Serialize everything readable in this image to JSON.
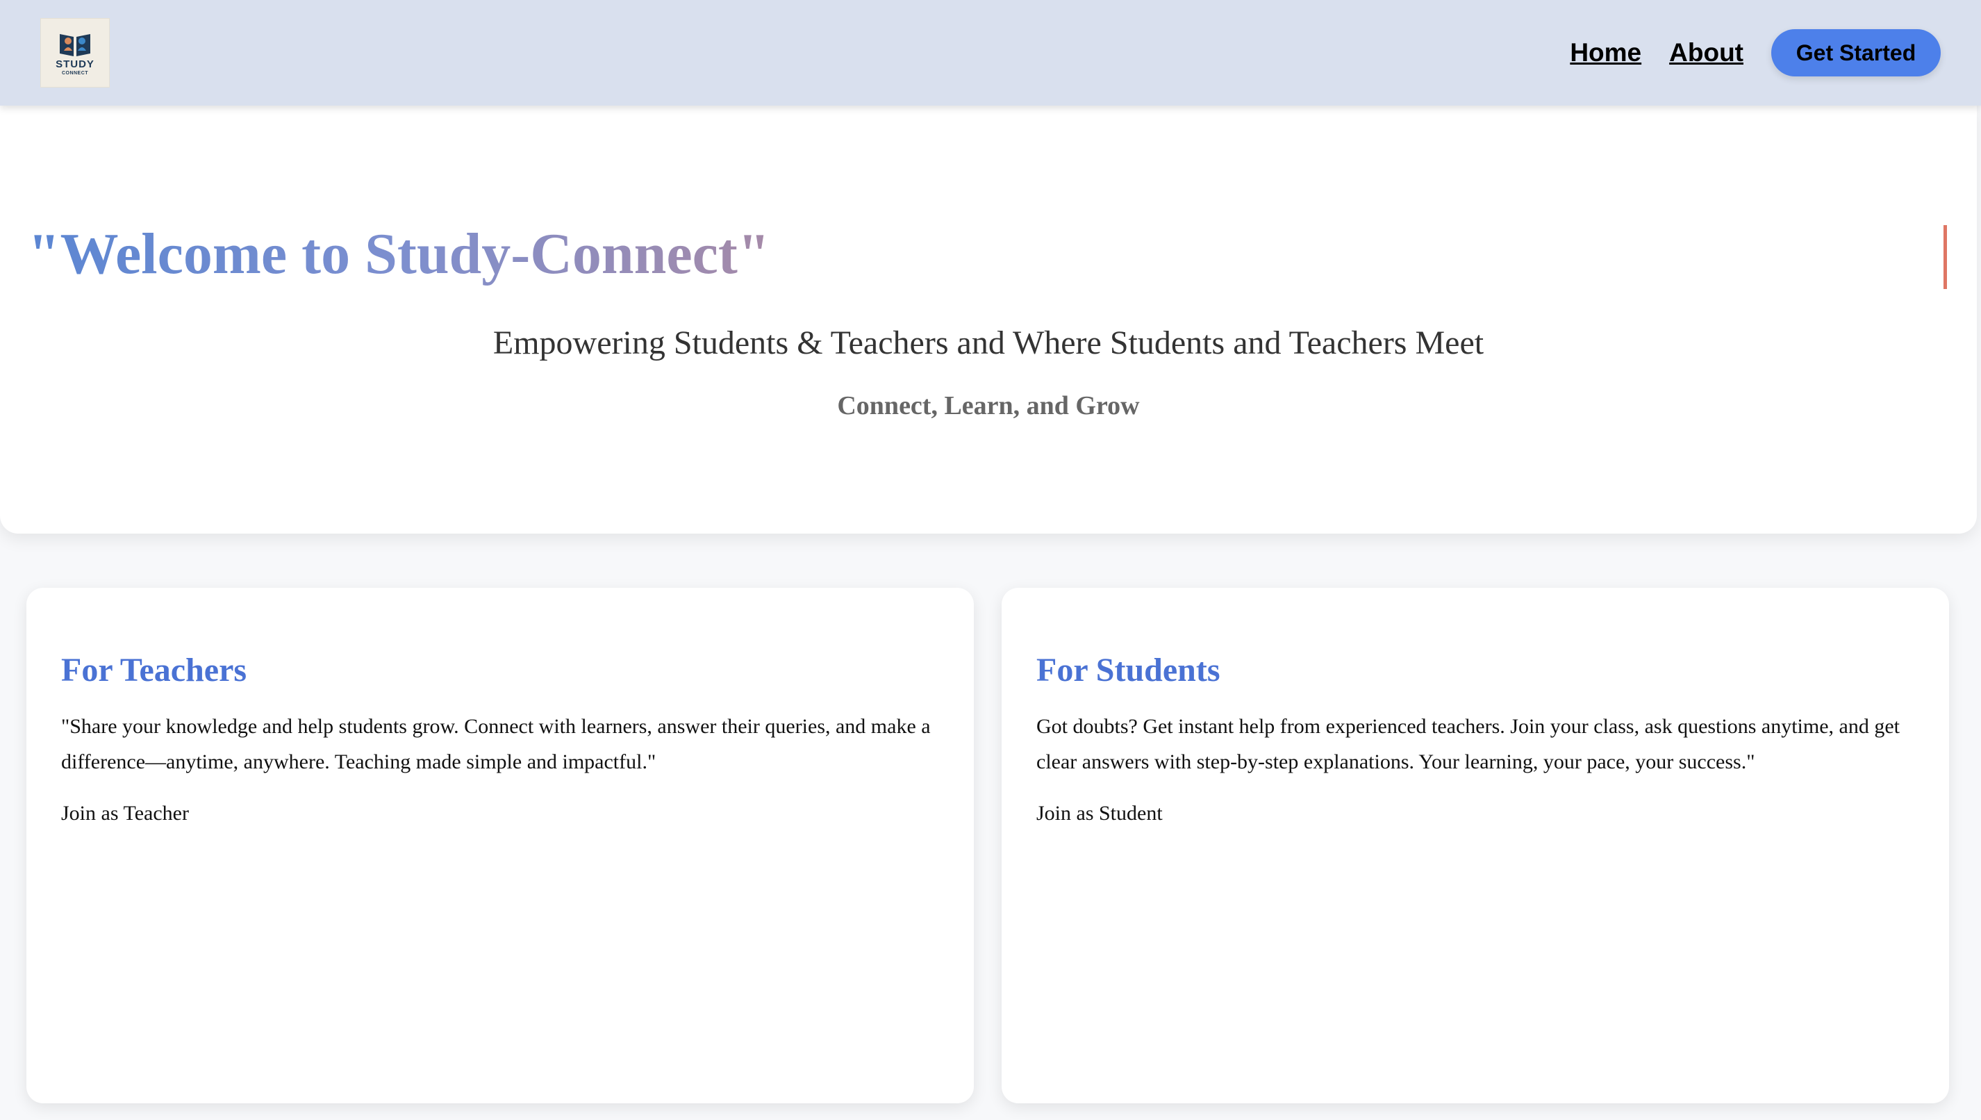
{
  "nav": {
    "logo": {
      "alt": "Study Connect logo",
      "line1": "STUDY",
      "line2": "CONNECT"
    },
    "links": {
      "home": "Home",
      "about": "About"
    },
    "cta_label": "Get Started"
  },
  "hero": {
    "title": "\"Welcome to Study-Connect\"",
    "subtitle": "Empowering Students & Teachers and Where Students and Teachers Meet",
    "tagline": "Connect, Learn, and Grow"
  },
  "cards": {
    "teachers": {
      "title": "For Teachers",
      "text": "\"Share your knowledge and help students grow. Connect with learners, answer their queries, and make a difference—anytime, anywhere. Teaching made simple and impactful.\"",
      "action": "Join as Teacher"
    },
    "students": {
      "title": "For Students",
      "text": "Got doubts? Get instant help from experienced teachers. Join your class, ask questions anytime, and get clear answers with step-by-step explanations. Your learning, your pace, your success.\"",
      "action": "Join as Student"
    }
  },
  "colors": {
    "nav_bg": "#d9e0ee",
    "cta_bg": "#4d80ea",
    "title_gradient_start": "#5b86d2",
    "title_gradient_end": "#a58aa8",
    "card_title": "#4a72d4",
    "caret": "#df7664"
  },
  "icons": {
    "logo": "open-book-logo-icon"
  }
}
